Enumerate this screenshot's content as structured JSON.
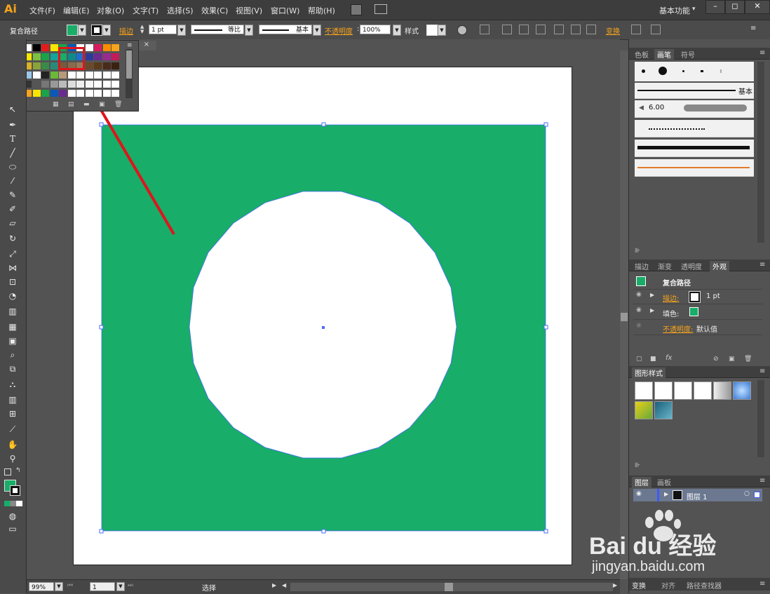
{
  "app": {
    "logo": "Ai",
    "workspace": "基本功能"
  },
  "menu": {
    "items": [
      "文件(F)",
      "编辑(E)",
      "对象(O)",
      "文字(T)",
      "选择(S)",
      "效果(C)",
      "视图(V)",
      "窗口(W)",
      "帮助(H)"
    ]
  },
  "window_controls": {
    "minimize": "–",
    "restore": "◻",
    "close": "✕"
  },
  "control_bar": {
    "object_type": "复合路径",
    "stroke_label": "描边",
    "stroke_weight": "1 pt",
    "stroke_profile": "等比",
    "brush": "基本",
    "opacity_label": "不透明度",
    "opacity_value": "100%",
    "style_label": "样式",
    "transform_label": "变换"
  },
  "document": {
    "tab_close": "×"
  },
  "status_bar": {
    "zoom": "99%",
    "page": "1",
    "mode": "选择"
  },
  "brush_panel": {
    "tabs": [
      "色板",
      "画笔",
      "符号"
    ],
    "active_tab": "画笔",
    "basic_label": "基本",
    "size_label": "6.00"
  },
  "appearance_panel": {
    "tabs": [
      "描边",
      "渐变",
      "透明度",
      "外观"
    ],
    "active_tab": "外观",
    "title": "复合路径",
    "stroke_label": "描边:",
    "stroke_value": "1 pt",
    "fill_label": "填色:",
    "opacity_label": "不透明度:",
    "opacity_value": "默认值"
  },
  "graphic_styles_panel": {
    "title": "图形样式"
  },
  "layers_panel": {
    "tabs": [
      "图层",
      "画板"
    ],
    "active_tab": "图层",
    "layer_name": "图层 1"
  },
  "bottom_tabs": {
    "items": [
      "变换",
      "对齐",
      "路径查找器"
    ]
  },
  "watermark": {
    "brand_line": "Bai du 经验",
    "url": "jingyan.baidu.com"
  },
  "colors": {
    "fill_green": "#18ad68",
    "selection_blue": "#4a6cff",
    "annotation_red": "#e0141c"
  }
}
